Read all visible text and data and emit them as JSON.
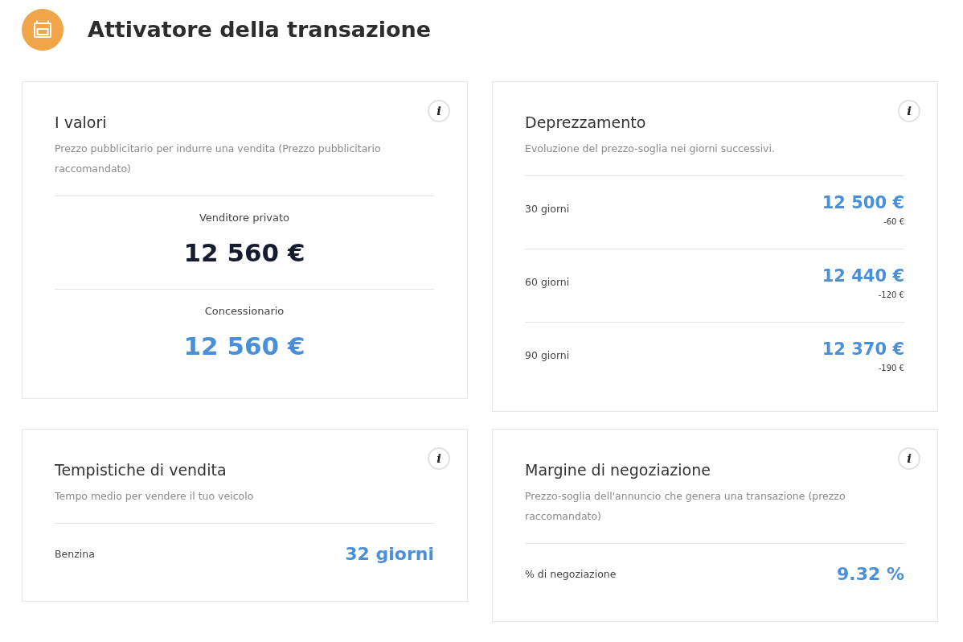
{
  "header": {
    "title": "Attivatore della transazione"
  },
  "cards": [
    {
      "kind": "values",
      "title": "I valori",
      "info": "i",
      "subtitle": "Prezzo pubblicitario per indurre una vendita (Prezzo pubblicitario raccomandato)",
      "entries": [
        {
          "label": "Venditore privato",
          "value": "12 560 €",
          "color": "#161b2f"
        },
        {
          "label": "Concessionario",
          "value": "12 560 €",
          "color": "#4a90d9"
        }
      ]
    },
    {
      "kind": "depreciation",
      "title": "Deprezzamento",
      "info": "i",
      "subtitle": "Evoluzione del prezzo-soglia nei giorni successivi.",
      "rows": [
        {
          "label": "30 giorni",
          "value": "12 500 €",
          "delta": "-60 €"
        },
        {
          "label": "60 giorni",
          "value": "12 440 €",
          "delta": "-120 €"
        },
        {
          "label": "90 giorni",
          "value": "12 370 €",
          "delta": "-190 €"
        }
      ]
    },
    {
      "kind": "metric",
      "title": "Tempistiche di vendita",
      "info": "i",
      "subtitle": "Tempo medio per vendere il tuo veicolo",
      "rows": [
        {
          "label": "Benzina",
          "value": "32 giorni"
        }
      ]
    },
    {
      "kind": "metric",
      "title": "Margine di negoziazione",
      "info": "i",
      "subtitle": "Prezzo-soglia dell'annuncio che genera una transazione (prezzo raccomandato)",
      "rows": [
        {
          "label": "% di negoziazione",
          "value": "9.32 %"
        }
      ]
    }
  ]
}
